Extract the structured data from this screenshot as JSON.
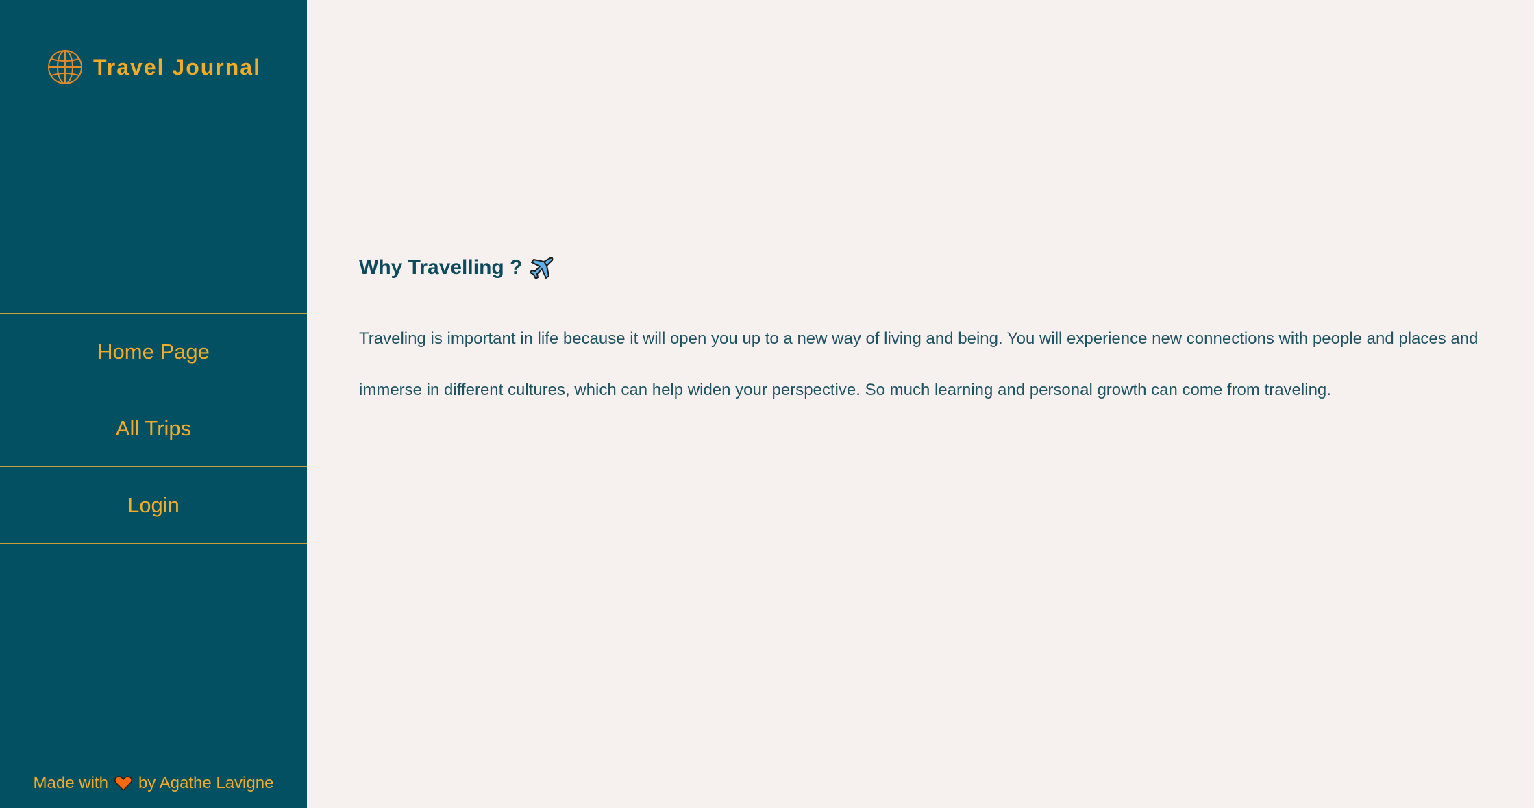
{
  "sidebar": {
    "brand": "Travel Journal",
    "brand_icon": "globe-icon",
    "nav": [
      {
        "label": "Home Page"
      },
      {
        "label": "All Trips"
      },
      {
        "label": "Login"
      }
    ],
    "footer": {
      "prefix": "Made with",
      "icon": "heart-icon",
      "suffix": "by Agathe Lavigne"
    }
  },
  "main": {
    "heading": "Why Travelling ?",
    "heading_icon": "airplane-icon",
    "paragraph": "Traveling is important in life because it will open you up to a new way of living and being. You will experience new connections with people and places and immerse in different cultures, which can help widen your perspective. So much learning and personal growth can come from traveling."
  },
  "colors": {
    "sidebar_bg": "#035063",
    "accent": "#f4ab27",
    "page_bg": "#f6f0ef",
    "text": "#1e5361"
  }
}
